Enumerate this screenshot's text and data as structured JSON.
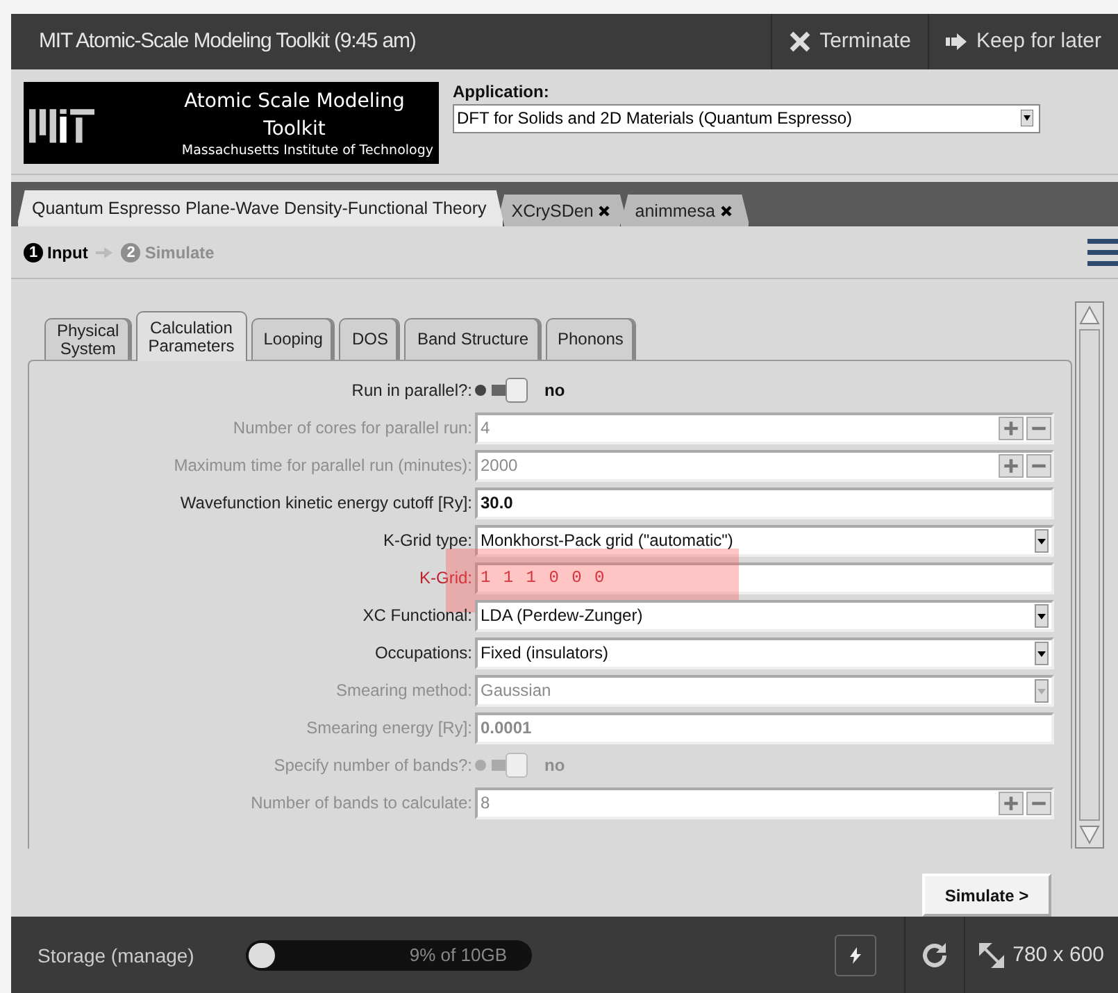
{
  "window": {
    "title": "MIT Atomic-Scale Modeling Toolkit (9:45 am)",
    "actions": [
      {
        "kind": "terminate",
        "label": "Terminate"
      },
      {
        "kind": "keep",
        "label": "Keep for later"
      }
    ]
  },
  "logo": {
    "title": "Atomic Scale Modeling Toolkit",
    "subtitle": "Massachusetts Institute of Technology"
  },
  "application": {
    "label": "Application:",
    "value": "DFT for Solids and 2D Materials (Quantum Espresso)"
  },
  "tool_tabs": [
    {
      "label": "Quantum Espresso Plane-Wave Density-Functional Theory",
      "selected": true,
      "closable": false
    },
    {
      "label": "XCrySDen",
      "selected": false,
      "closable": true
    },
    {
      "label": "animmesa",
      "selected": false,
      "closable": true
    }
  ],
  "steps": [
    {
      "number": "1",
      "label": "Input",
      "selected": true
    },
    {
      "number": "2",
      "label": "Simulate",
      "selected": false
    }
  ],
  "form_tabs": [
    {
      "label": "Physical\nSystem",
      "selected": false
    },
    {
      "label": "Calculation\nParameters",
      "selected": true
    },
    {
      "label": "Looping",
      "selected": false
    },
    {
      "label": "DOS",
      "selected": false
    },
    {
      "label": "Band Structure",
      "selected": false
    },
    {
      "label": "Phonons",
      "selected": false
    }
  ],
  "fields": [
    {
      "kind": "toggle",
      "label": "Run in parallel?:",
      "value": "no",
      "on": false,
      "disabled": false
    },
    {
      "kind": "number",
      "label": "Number of cores for parallel run:",
      "value": "4",
      "disabled": true
    },
    {
      "kind": "number",
      "label": "Maximum time for parallel run (minutes):",
      "value": "2000",
      "disabled": true
    },
    {
      "kind": "value",
      "label": "Wavefunction kinetic energy cutoff [Ry]:",
      "value": "30.0",
      "disabled": false
    },
    {
      "kind": "select",
      "label": "K-Grid type:",
      "value": "Monkhorst-Pack grid (\"automatic\")",
      "disabled": false
    },
    {
      "kind": "text",
      "label": "K-Grid:",
      "value": "1 1 1 0 0 0",
      "disabled": false,
      "highlighted": true
    },
    {
      "kind": "select",
      "label": "XC Functional:",
      "value": "LDA (Perdew-Zunger)",
      "disabled": false
    },
    {
      "kind": "select",
      "label": "Occupations:",
      "value": "Fixed (insulators)",
      "disabled": false
    },
    {
      "kind": "select",
      "label": "Smearing method:",
      "value": "Gaussian",
      "disabled": true
    },
    {
      "kind": "value",
      "label": "Smearing energy [Ry]:",
      "value": "0.0001",
      "disabled": true
    },
    {
      "kind": "toggle",
      "label": "Specify number of bands?:",
      "value": "no",
      "on": false,
      "disabled": true
    },
    {
      "kind": "number",
      "label": "Number of bands to calculate:",
      "value": "8",
      "disabled": true
    }
  ],
  "simulate_button": "Simulate >",
  "status_bar": {
    "storage_label": "Storage (manage)",
    "level": 0.09,
    "storage_reading": "9% of 10GB",
    "size": "780 x 600"
  }
}
